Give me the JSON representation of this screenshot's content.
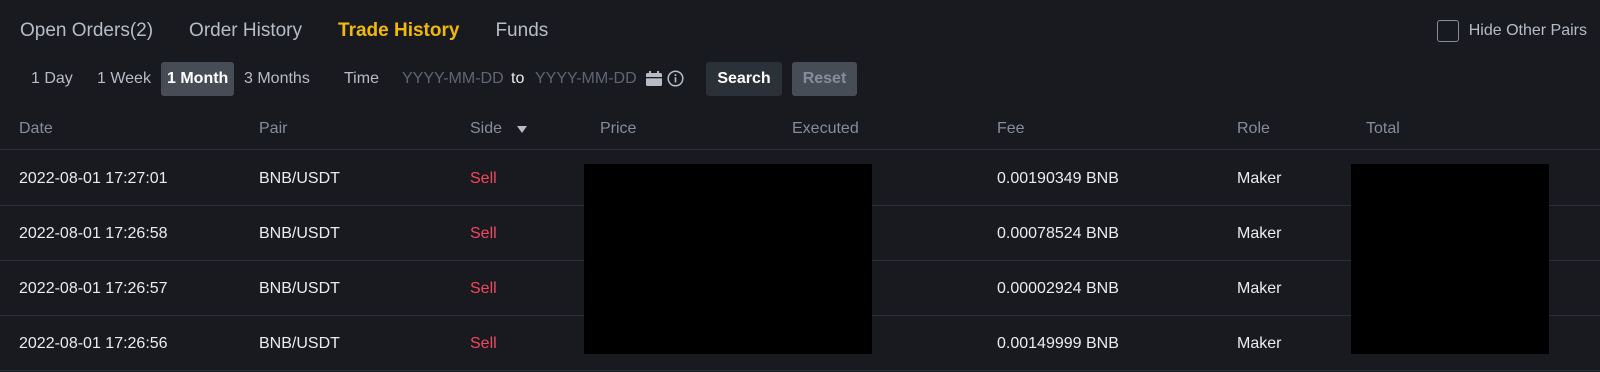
{
  "tabs": [
    {
      "label": "Open Orders(2)",
      "active": false
    },
    {
      "label": "Order History",
      "active": false
    },
    {
      "label": "Trade History",
      "active": true
    },
    {
      "label": "Funds",
      "active": false
    }
  ],
  "hide_other_pairs": {
    "label": "Hide Other Pairs",
    "checked": false
  },
  "filters": {
    "ranges": [
      {
        "label": "1 Day",
        "active": false
      },
      {
        "label": "1 Week",
        "active": false
      },
      {
        "label": "1 Month",
        "active": true
      },
      {
        "label": "3 Months",
        "active": false
      }
    ],
    "time_label": "Time",
    "start_placeholder": "YYYY-MM-DD",
    "to_label": "to",
    "end_placeholder": "YYYY-MM-DD",
    "search_label": "Search",
    "reset_label": "Reset"
  },
  "table": {
    "columns": [
      "Date",
      "Pair",
      "Side",
      "Price",
      "Executed",
      "Fee",
      "Role",
      "Total"
    ],
    "rows": [
      {
        "date": "2022-08-01 17:27:01",
        "pair": "BNB/USDT",
        "side": "Sell",
        "fee": "0.00190349 BNB",
        "role": "Maker"
      },
      {
        "date": "2022-08-01 17:26:58",
        "pair": "BNB/USDT",
        "side": "Sell",
        "fee": "0.00078524 BNB",
        "role": "Maker"
      },
      {
        "date": "2022-08-01 17:26:57",
        "pair": "BNB/USDT",
        "side": "Sell",
        "fee": "0.00002924 BNB",
        "role": "Maker"
      },
      {
        "date": "2022-08-01 17:26:56",
        "pair": "BNB/USDT",
        "side": "Sell",
        "fee": "0.00149999 BNB",
        "role": "Maker"
      }
    ]
  },
  "colors": {
    "background": "#181a20",
    "accent": "#f0b90b",
    "sell": "#f6465d",
    "muted": "#848e9c"
  }
}
